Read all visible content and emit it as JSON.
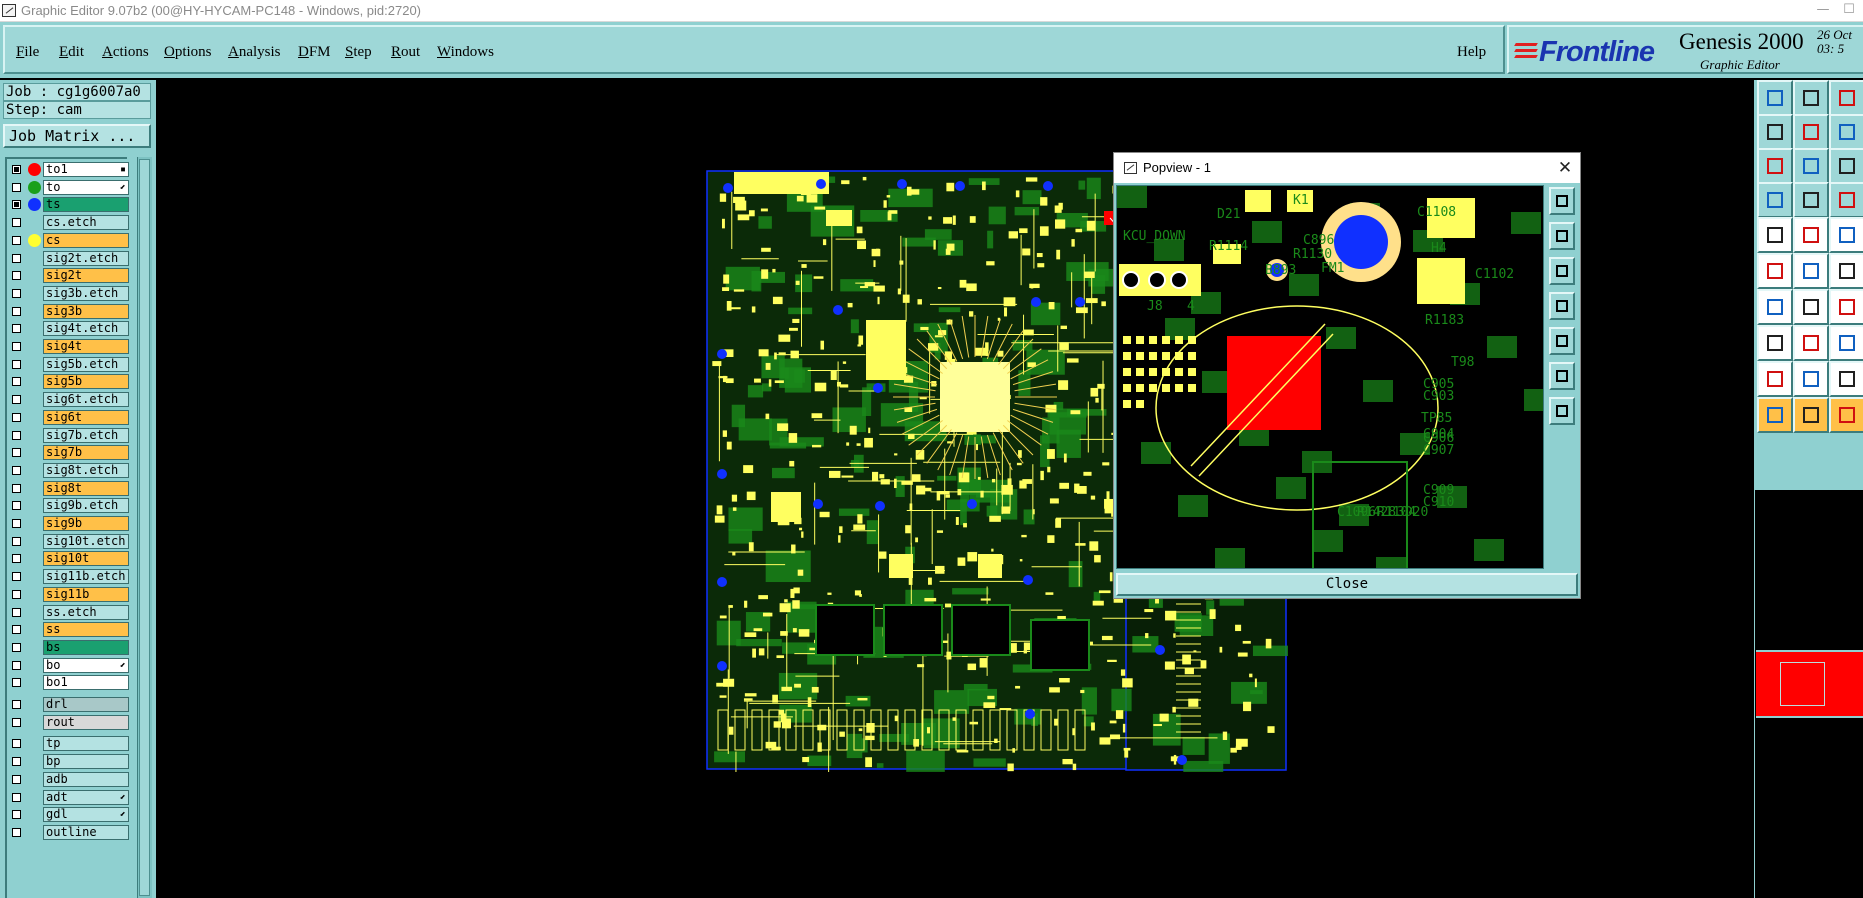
{
  "window": {
    "title": "Graphic Editor 9.07b2 (00@HY-HYCAM-PC148 - Windows, pid:2720)",
    "min_glyph": "—",
    "max_glyph": "☐"
  },
  "menu": {
    "items": [
      {
        "mnemonic": "F",
        "rest": "ile"
      },
      {
        "mnemonic": "E",
        "rest": "dit"
      },
      {
        "mnemonic": "A",
        "rest": "ctions"
      },
      {
        "mnemonic": "O",
        "rest": "ptions"
      },
      {
        "mnemonic": "A",
        "rest": "nalysis"
      },
      {
        "mnemonic": "D",
        "rest": "FM"
      },
      {
        "mnemonic": "S",
        "rest": "tep"
      },
      {
        "mnemonic": "R",
        "rest": "out"
      },
      {
        "mnemonic": "W",
        "rest": "indows"
      }
    ],
    "help": "Help"
  },
  "brand": {
    "logo": "Frontline",
    "product": "Genesis 2000",
    "subtitle": "Graphic Editor",
    "date_line1": "26 Oct",
    "date_line2": "03: 5"
  },
  "job": {
    "job_line": "Job : cg1g6007a0",
    "step_line": "Step: cam",
    "matrix_button": "Job Matrix ..."
  },
  "layers": [
    {
      "name": "to1",
      "bg": "#ffffff",
      "dot": "#ff0000",
      "checked": true,
      "flag": "▪"
    },
    {
      "name": "to",
      "bg": "#ffffff",
      "dot": "#1aa01a",
      "checked": false,
      "flag": "⬋"
    },
    {
      "name": "ts",
      "bg": "#1aa070",
      "dot": "#1030ff",
      "checked": true,
      "flag": ""
    },
    {
      "name": "cs.etch",
      "bg": "#b4e2e2",
      "dot": "",
      "checked": false,
      "flag": ""
    },
    {
      "name": "cs",
      "bg": "#ffc048",
      "dot": "#ffff30",
      "checked": false,
      "flag": ""
    },
    {
      "name": "sig2t.etch",
      "bg": "#b4e2e2",
      "dot": "",
      "checked": false,
      "flag": ""
    },
    {
      "name": "sig2t",
      "bg": "#ffc048",
      "dot": "",
      "checked": false,
      "flag": ""
    },
    {
      "name": "sig3b.etch",
      "bg": "#b4e2e2",
      "dot": "",
      "checked": false,
      "flag": ""
    },
    {
      "name": "sig3b",
      "bg": "#ffc048",
      "dot": "",
      "checked": false,
      "flag": ""
    },
    {
      "name": "sig4t.etch",
      "bg": "#b4e2e2",
      "dot": "",
      "checked": false,
      "flag": ""
    },
    {
      "name": "sig4t",
      "bg": "#ffc048",
      "dot": "",
      "checked": false,
      "flag": ""
    },
    {
      "name": "sig5b.etch",
      "bg": "#b4e2e2",
      "dot": "",
      "checked": false,
      "flag": ""
    },
    {
      "name": "sig5b",
      "bg": "#ffc048",
      "dot": "",
      "checked": false,
      "flag": ""
    },
    {
      "name": "sig6t.etch",
      "bg": "#b4e2e2",
      "dot": "",
      "checked": false,
      "flag": ""
    },
    {
      "name": "sig6t",
      "bg": "#ffc048",
      "dot": "",
      "checked": false,
      "flag": ""
    },
    {
      "name": "sig7b.etch",
      "bg": "#b4e2e2",
      "dot": "",
      "checked": false,
      "flag": ""
    },
    {
      "name": "sig7b",
      "bg": "#ffc048",
      "dot": "",
      "checked": false,
      "flag": ""
    },
    {
      "name": "sig8t.etch",
      "bg": "#b4e2e2",
      "dot": "",
      "checked": false,
      "flag": ""
    },
    {
      "name": "sig8t",
      "bg": "#ffc048",
      "dot": "",
      "checked": false,
      "flag": ""
    },
    {
      "name": "sig9b.etch",
      "bg": "#b4e2e2",
      "dot": "",
      "checked": false,
      "flag": ""
    },
    {
      "name": "sig9b",
      "bg": "#ffc048",
      "dot": "",
      "checked": false,
      "flag": ""
    },
    {
      "name": "sig10t.etch",
      "bg": "#b4e2e2",
      "dot": "",
      "checked": false,
      "flag": ""
    },
    {
      "name": "sig10t",
      "bg": "#ffc048",
      "dot": "",
      "checked": false,
      "flag": ""
    },
    {
      "name": "sig11b.etch",
      "bg": "#b4e2e2",
      "dot": "",
      "checked": false,
      "flag": ""
    },
    {
      "name": "sig11b",
      "bg": "#ffc048",
      "dot": "",
      "checked": false,
      "flag": ""
    },
    {
      "name": "ss.etch",
      "bg": "#b4e2e2",
      "dot": "",
      "checked": false,
      "flag": ""
    },
    {
      "name": "ss",
      "bg": "#ffc048",
      "dot": "",
      "checked": false,
      "flag": ""
    },
    {
      "name": "bs",
      "bg": "#1aa070",
      "dot": "",
      "checked": false,
      "flag": ""
    },
    {
      "name": "bo",
      "bg": "#ffffff",
      "dot": "",
      "checked": false,
      "flag": "⬋"
    },
    {
      "name": "bo1",
      "bg": "#ffffff",
      "dot": "",
      "checked": false,
      "flag": ""
    },
    {
      "name": "drl",
      "bg": "#a8c8c8",
      "dot": "",
      "checked": false,
      "flag": ""
    },
    {
      "name": "rout",
      "bg": "#d8d8d8",
      "dot": "",
      "checked": false,
      "flag": ""
    },
    {
      "name": "tp",
      "bg": "#b4e2e2",
      "dot": "",
      "checked": false,
      "flag": ""
    },
    {
      "name": "bp",
      "bg": "#b4e2e2",
      "dot": "",
      "checked": false,
      "flag": ""
    },
    {
      "name": "adb",
      "bg": "#b4e2e2",
      "dot": "",
      "checked": false,
      "flag": ""
    },
    {
      "name": "adt",
      "bg": "#b4e2e2",
      "dot": "",
      "checked": false,
      "flag": "⬋"
    },
    {
      "name": "gdl",
      "bg": "#b4e2e2",
      "dot": "",
      "checked": false,
      "flag": "⬋"
    },
    {
      "name": "outline",
      "bg": "#b4e2e2",
      "dot": "",
      "checked": false,
      "flag": ""
    }
  ],
  "popview": {
    "title": "Popview - 1",
    "close_x": "✕",
    "close_button": "Close",
    "labels": [
      "J8",
      "4",
      "D21",
      "R1130",
      "C896",
      "FM1",
      "KCU_DOWN",
      "H4",
      "C1108",
      "C1102",
      "R1183",
      "TP85",
      "C907",
      "C906",
      "C905",
      "C903",
      "C904",
      "C910",
      "C909",
      "C1096",
      "R1428",
      "R1104",
      "3D20",
      "B893",
      "R1114",
      "T98",
      "K1"
    ]
  },
  "colors": {
    "panel": "#8fd0d0",
    "pcb_yellow": "#ffff60",
    "pcb_green": "#1a8a1a",
    "highlight_red": "#ff0000",
    "via_blue": "#1030ff"
  }
}
